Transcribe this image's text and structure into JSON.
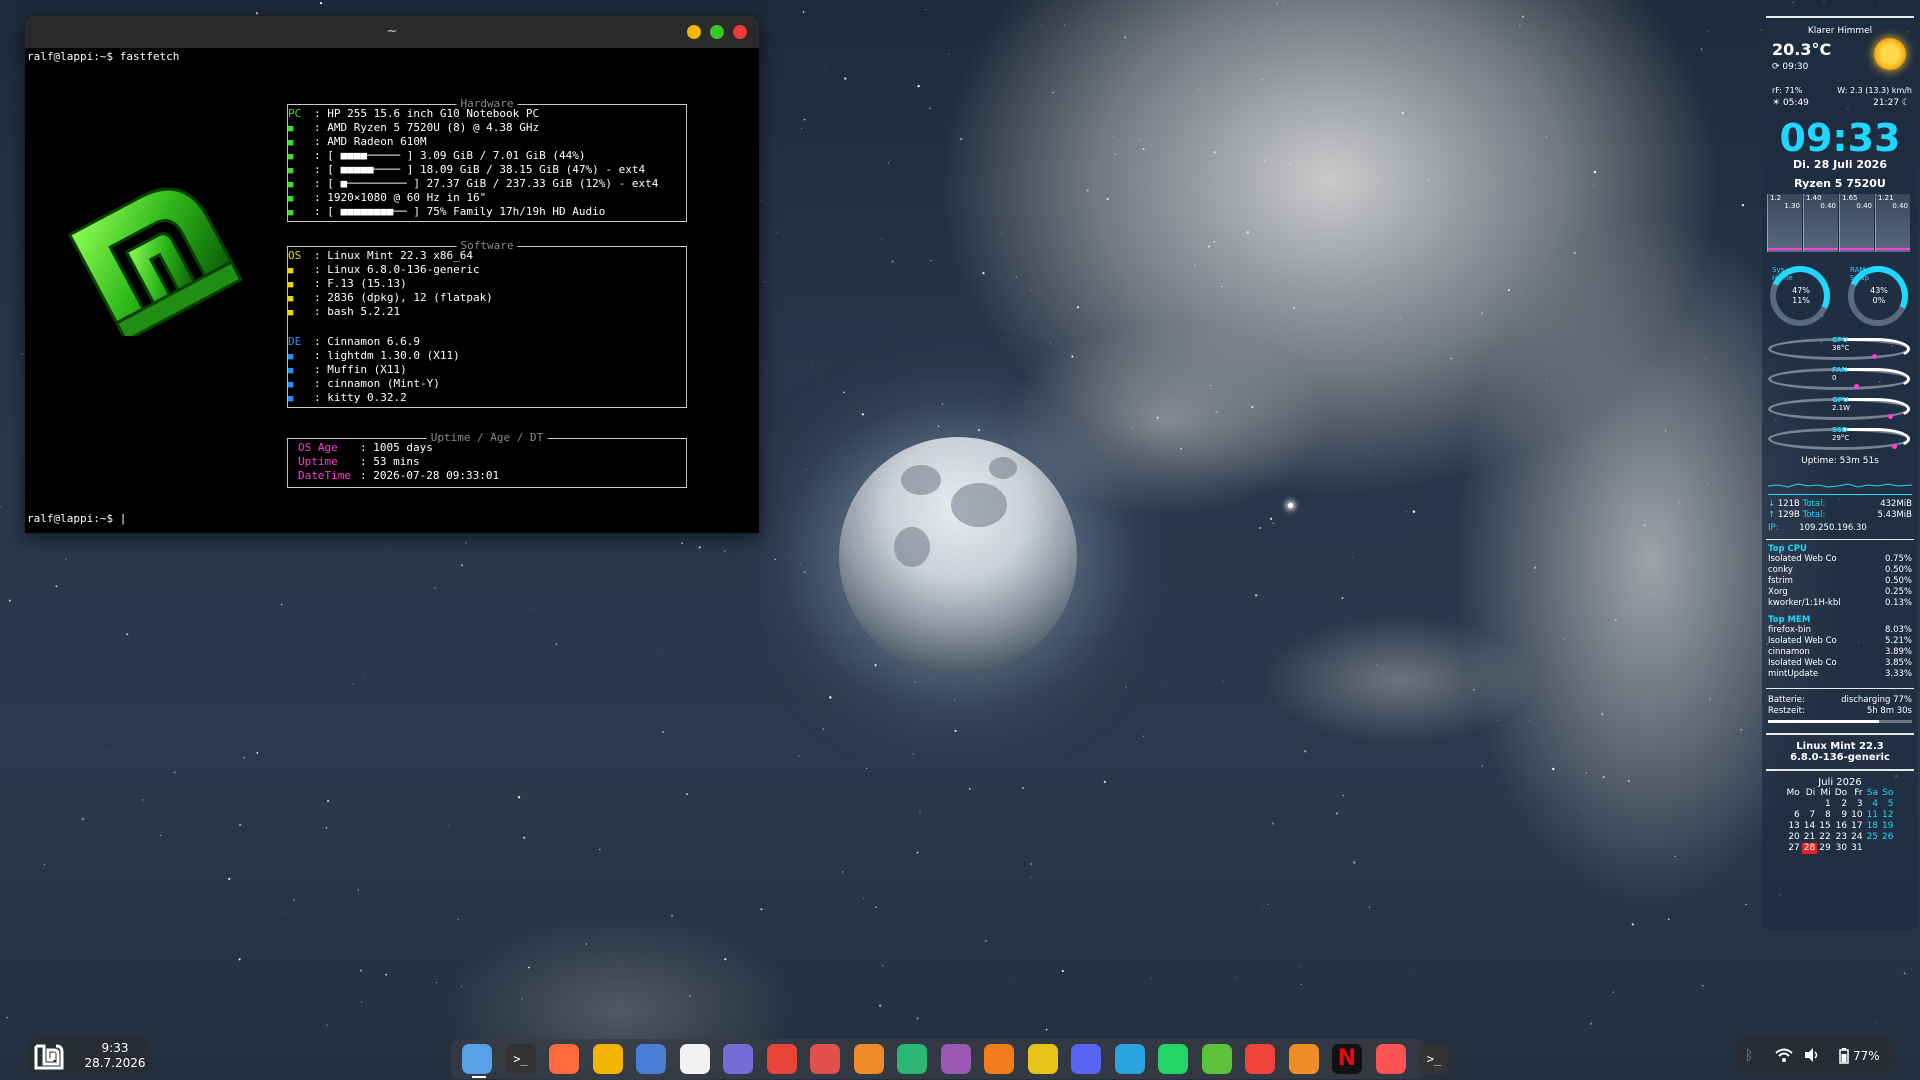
{
  "terminal": {
    "title": "~",
    "prompt1": "ralf@lappi:~$ fastfetch",
    "prompt2": "ralf@lappi:~$ |",
    "hardware_label": "Hardware",
    "software_label": "Software",
    "uptime_label": "Uptime / Age / DT",
    "hardware": [
      {
        "key": "PC",
        "val": ": HP 255 15.6 inch G10 Notebook PC"
      },
      {
        "key": "",
        "val": ": AMD Ryzen 5 7520U (8) @ 4.38 GHz"
      },
      {
        "key": "",
        "val": ": AMD Radeon 610M"
      },
      {
        "key": "",
        "val": ": [ ■■■■───── ] 3.09 GiB / 7.01 GiB (44%)"
      },
      {
        "key": "",
        "val": ": [ ■■■■■──── ] 18.09 GiB / 38.15 GiB (47%) - ext4"
      },
      {
        "key": "",
        "val": ": [ ■───────── ] 27.37 GiB / 237.33 GiB (12%) - ext4"
      },
      {
        "key": "",
        "val": ": 1920×1080 @ 60 Hz in 16\""
      },
      {
        "key": "",
        "val": ": [ ■■■■■■■■── ] 75% Family 17h/19h HD Audio"
      }
    ],
    "software": [
      {
        "key": "OS",
        "val": ": Linux Mint 22.3 x86_64"
      },
      {
        "key": "",
        "val": ": Linux 6.8.0-136-generic"
      },
      {
        "key": "",
        "val": ": F.13 (15.13)"
      },
      {
        "key": "",
        "val": ": 2836 (dpkg), 12 (flatpak)"
      },
      {
        "key": "",
        "val": ": bash 5.2.21"
      }
    ],
    "desktop": [
      {
        "key": "DE",
        "val": ": Cinnamon 6.6.9"
      },
      {
        "key": "",
        "val": ": lightdm 1.30.0 (X11)"
      },
      {
        "key": "",
        "val": ": Muffin (X11)"
      },
      {
        "key": "",
        "val": ": cinnamon (Mint-Y)"
      },
      {
        "key": "",
        "val": ": kitty 0.32.2"
      }
    ],
    "uptime": [
      {
        "key": "OS Age",
        "val": ": 1005 days"
      },
      {
        "key": "Uptime",
        "val": ": 53 mins"
      },
      {
        "key": "DateTime",
        "val": ": 2026-07-28 09:33:01"
      }
    ]
  },
  "conky": {
    "weather_desc": "Klarer Himmel",
    "temp": "20.3°C",
    "weather_time": "09:30",
    "humidity": "rF: 71%",
    "wind": "W: 2.3 (13.3) km/h",
    "sunrise": "05:49",
    "sunset": "21:27",
    "clock": "09:33",
    "date": "Di. 28 Juli 2026",
    "cpu_name": "Ryzen 5 7520U",
    "cores_top": [
      "1.2",
      "1.40",
      "1.65",
      "1.21"
    ],
    "cores_bot": [
      "1.30",
      "0.40",
      "0.40",
      "0.40"
    ],
    "ring1": {
      "a": "Sys",
      "b": "Home",
      "p1": "47%",
      "p2": "11%"
    },
    "ring2": {
      "a": "RAM",
      "b": "Swap",
      "p1": "43%",
      "p2": "0%"
    },
    "sensors": [
      {
        "label": "CPU",
        "val": "38°C"
      },
      {
        "label": "FAN",
        "val": "0"
      },
      {
        "label": "GPU",
        "val": "2.1W"
      },
      {
        "label": "SSD",
        "val": "29°C"
      }
    ],
    "uptime": "Uptime: 53m 51s",
    "down": "121B",
    "down_total_lbl": "Total:",
    "down_total": "432MiB",
    "up": "129B",
    "up_total_lbl": "Total:",
    "up_total": "5.43MiB",
    "ip_label": "IP:",
    "ip": "109.250.196.30",
    "top_cpu_title": "Top CPU",
    "top_cpu": [
      {
        "n": "Isolated Web Co",
        "v": "0.75%"
      },
      {
        "n": "conky",
        "v": "0.50%"
      },
      {
        "n": "fstrim",
        "v": "0.50%"
      },
      {
        "n": "Xorg",
        "v": "0.25%"
      },
      {
        "n": "kworker/1:1H-kbl",
        "v": "0.13%"
      }
    ],
    "top_mem_title": "Top MEM",
    "top_mem": [
      {
        "n": "firefox-bin",
        "v": "8.03%"
      },
      {
        "n": "Isolated Web Co",
        "v": "5.21%"
      },
      {
        "n": "cinnamon",
        "v": "3.89%"
      },
      {
        "n": "Isolated Web Co",
        "v": "3.85%"
      },
      {
        "n": "mintUpdate",
        "v": "3.33%"
      }
    ],
    "battery_label": "Batterie:",
    "battery_val": "discharging 77%",
    "rest_label": "Restzeit:",
    "rest_val": "5h 8m 30s",
    "battery_level": 0.77,
    "distro": "Linux Mint 22.3",
    "kernel": "6.8.0-136-generic",
    "cal_title": "Juli 2026",
    "cal_head": [
      "Mo",
      "Di",
      "Mi",
      "Do",
      "Fr",
      "Sa",
      "So"
    ],
    "cal_rows": [
      [
        "",
        "",
        "1",
        "2",
        "3",
        "4",
        "5"
      ],
      [
        "6",
        "7",
        "8",
        "9",
        "10",
        "11",
        "12"
      ],
      [
        "13",
        "14",
        "15",
        "16",
        "17",
        "18",
        "19"
      ],
      [
        "20",
        "21",
        "22",
        "23",
        "24",
        "25",
        "26"
      ],
      [
        "27",
        "28",
        "29",
        "30",
        "31",
        "",
        ""
      ]
    ],
    "today": "28"
  },
  "panel": {
    "time": "9:33",
    "date": "28.7.2026",
    "battery": "77%",
    "dock_icons": [
      "files-icon",
      "terminal-icon",
      "firefox-icon",
      "chrome-icon",
      "mail-icon",
      "document-icon",
      "text-editor-icon",
      "screenshot-icon",
      "ebook-reader-icon",
      "office-icon",
      "media-player-icon",
      "video-player-icon",
      "vlc-icon",
      "pen-icon",
      "discord-icon",
      "telegram-icon",
      "whatsapp-icon",
      "keepassxc-icon",
      "anydesk-icon",
      "timeshift-icon",
      "netflix-icon",
      "screen-recorder-icon",
      "kitty-icon"
    ],
    "colors": {
      "accent": "#20d8ff",
      "magenta": "#ff3cd6",
      "green": "#3ddc2a"
    }
  }
}
